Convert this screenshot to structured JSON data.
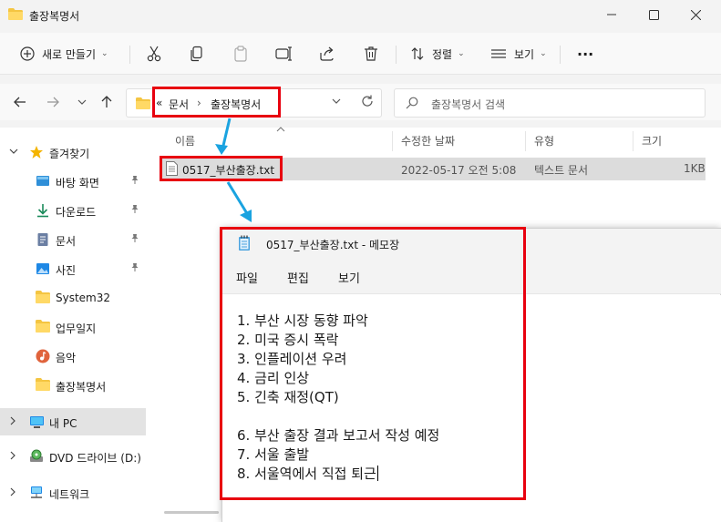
{
  "window": {
    "title": "출장복명서"
  },
  "toolbar": {
    "new_label": "새로 만들기",
    "sort_label": "정렬",
    "view_label": "보기",
    "more_label": "···"
  },
  "address": {
    "overflow": "«",
    "crumbs": [
      "문서",
      "출장복명서"
    ],
    "separator": "›"
  },
  "search": {
    "placeholder": "출장복명서 검색"
  },
  "sidebar": {
    "items": [
      {
        "label": "즐겨찾기",
        "icon": "star-icon"
      },
      {
        "label": "바탕 화면",
        "icon": "desktop-icon"
      },
      {
        "label": "다운로드",
        "icon": "download-icon"
      },
      {
        "label": "문서",
        "icon": "document-icon"
      },
      {
        "label": "사진",
        "icon": "pictures-icon"
      },
      {
        "label": "System32",
        "icon": "folder-icon"
      },
      {
        "label": "업무일지",
        "icon": "folder-icon"
      },
      {
        "label": "음악",
        "icon": "music-icon"
      },
      {
        "label": "출장복명서",
        "icon": "folder-icon"
      },
      {
        "label": "내 PC",
        "icon": "pc-icon"
      },
      {
        "label": "DVD 드라이브 (D:)",
        "icon": "dvd-icon"
      },
      {
        "label": "네트워크",
        "icon": "network-icon"
      }
    ]
  },
  "columns": {
    "name": "이름",
    "modified": "수정한 날짜",
    "type": "유형",
    "size": "크기"
  },
  "files": [
    {
      "name": "0517_부산출장.txt",
      "modified": "2022-05-17 오전 5:08",
      "type": "텍스트 문서",
      "size": "1KB"
    }
  ],
  "notepad": {
    "title": "0517_부산출장.txt - 메모장",
    "menu": [
      "파일",
      "편집",
      "보기"
    ],
    "lines": [
      "1. 부산 시장 동향 파악",
      "2. 미국 증시 폭락",
      "3. 인플레이션 우려",
      "4. 금리 인상",
      "5. 긴축 재정(QT)",
      "",
      "6. 부산 출장 결과 보고서 작성 예정",
      "7. 서울 출발",
      "8. 서울역에서 직접 퇴근"
    ]
  },
  "colors": {
    "annotation": "#e8000f",
    "arrow": "#1aa3e0",
    "folder": "#f4c542"
  }
}
